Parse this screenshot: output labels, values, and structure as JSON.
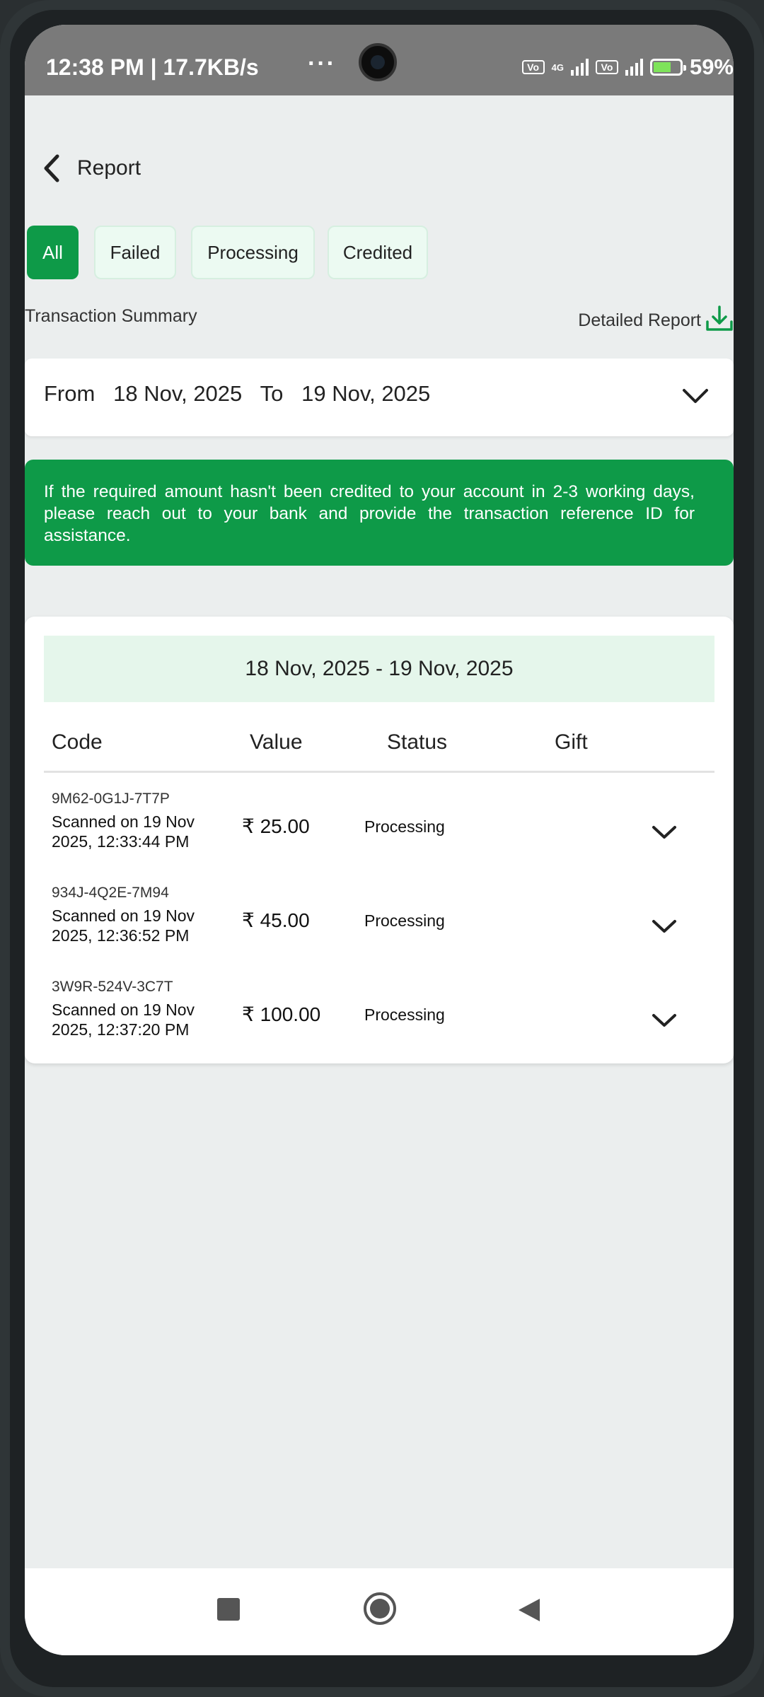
{
  "status_bar": {
    "time": "12:38 PM | 17.7KB/s",
    "more": "···",
    "net_type": "4G",
    "volte": "Vo LTE",
    "battery": "59%"
  },
  "header": {
    "title": "Report"
  },
  "filters": [
    {
      "label": "All",
      "selected": true
    },
    {
      "label": "Failed",
      "selected": false
    },
    {
      "label": "Processing",
      "selected": false
    },
    {
      "label": "Credited",
      "selected": false
    }
  ],
  "summary_label": "Transaction Summary",
  "detailed_report_label": "Detailed Report",
  "date_filter": {
    "from_label": "From",
    "from_date": "18 Nov, 2025",
    "to_label": "To",
    "to_date": "19 Nov, 2025"
  },
  "notice": "If the required amount hasn't been credited to your account in 2-3 working days, please reach out to your bank and provide the transaction reference ID for assistance.",
  "transactions": {
    "range": "18 Nov, 2025 - 19 Nov, 2025",
    "columns": [
      "Code",
      "Value",
      "Status",
      "Gift"
    ],
    "rows": [
      {
        "code": "9M62-0G1J-7T7P",
        "scanned": "Scanned on 19 Nov 2025, 12:33:44 PM",
        "value": "₹ 25.00",
        "status": "Processing"
      },
      {
        "code": "934J-4Q2E-7M94",
        "scanned": "Scanned on 19 Nov 2025, 12:36:52 PM",
        "value": "₹ 45.00",
        "status": "Processing"
      },
      {
        "code": "3W9R-524V-3C7T",
        "scanned": "Scanned on 19 Nov 2025, 12:37:20 PM",
        "value": "₹ 100.00",
        "status": "Processing"
      }
    ]
  },
  "colors": {
    "accent": "#0e9a48",
    "chip_bg": "#ecfaf2",
    "range_bg": "#e5f6eb",
    "page_bg": "#ebeeee"
  },
  "icons": {
    "back": "chevron-left-icon",
    "download": "download-icon",
    "expand": "chevron-down-icon",
    "nav_recents": "square-icon",
    "nav_home": "circle-icon",
    "nav_back": "triangle-left-icon"
  }
}
